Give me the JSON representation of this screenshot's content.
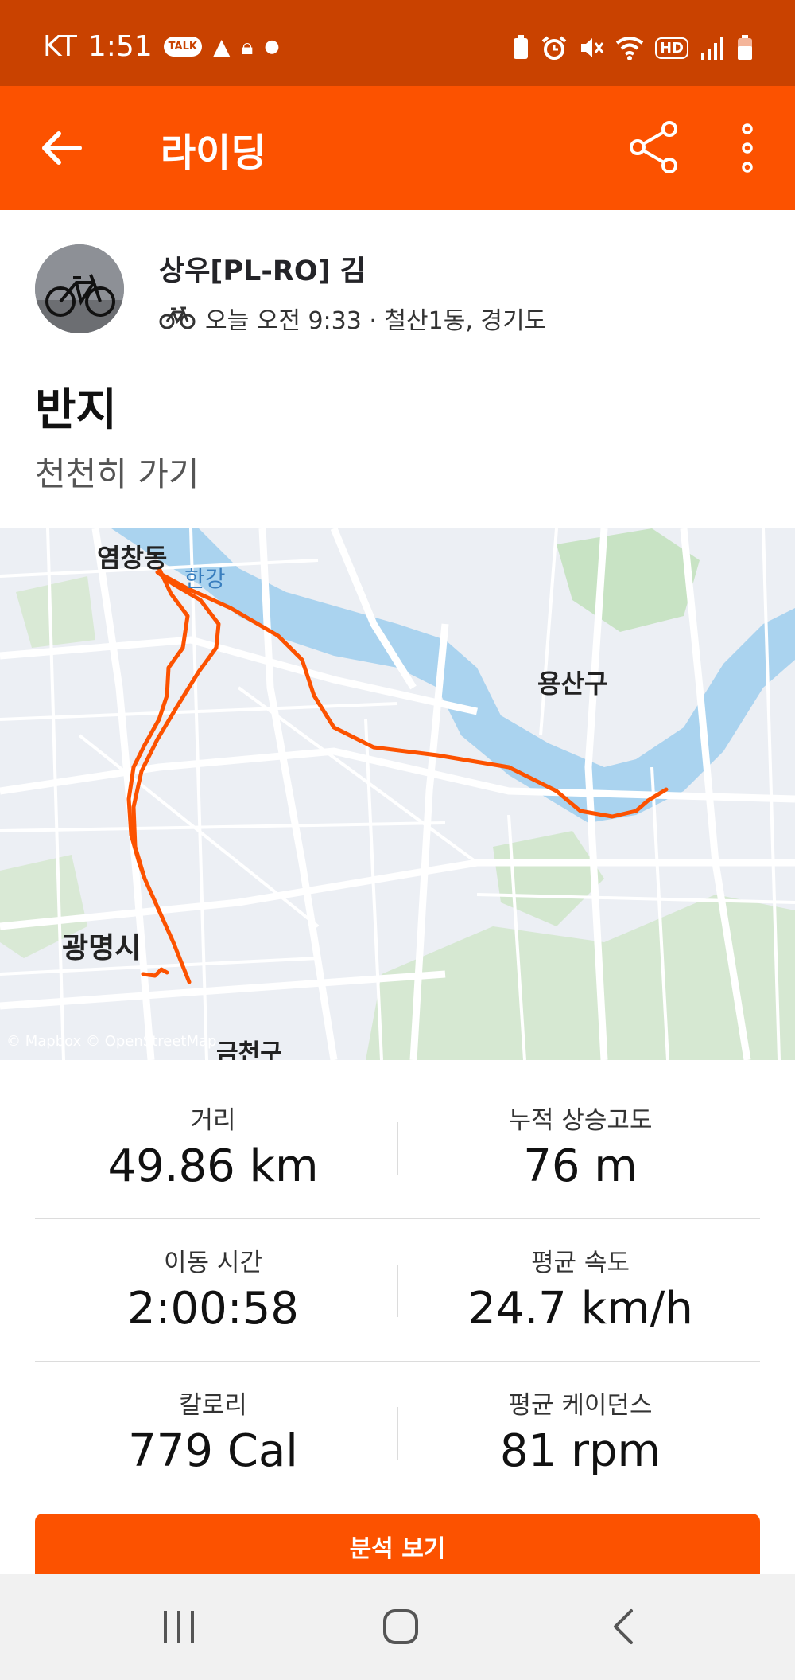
{
  "status_bar": {
    "carrier": "KT",
    "time": "1:51",
    "talk": "TALK",
    "hd": "HD"
  },
  "app_bar": {
    "title": "라이딩"
  },
  "athlete": {
    "name": "상우[PL-RO] 김",
    "meta": "오늘 오전 9:33 · 철산1동, 경기도"
  },
  "activity": {
    "title": "반지",
    "description": "천천히 가기"
  },
  "map": {
    "labels": [
      "염창동",
      "한강",
      "용산구",
      "광명시",
      "금천구"
    ],
    "attribution": "© Mapbox © OpenStreetMap",
    "colors": {
      "route": "#fc5200",
      "water": "#aad3ef",
      "park": "#c8e3c4",
      "road": "#ffffff"
    }
  },
  "stats": [
    {
      "label": "거리",
      "value": "49.86 km"
    },
    {
      "label": "누적 상승고도",
      "value": "76 m"
    },
    {
      "label": "이동 시간",
      "value": "2:00:58"
    },
    {
      "label": "평균 속도",
      "value": "24.7 km/h"
    },
    {
      "label": "칼로리",
      "value": "779 Cal"
    },
    {
      "label": "평균 케이던스",
      "value": "81 rpm"
    }
  ],
  "analysis_button": {
    "label": "분석 보기"
  },
  "colors": {
    "brand": "#fc5200",
    "status_bar": "#c94200"
  }
}
